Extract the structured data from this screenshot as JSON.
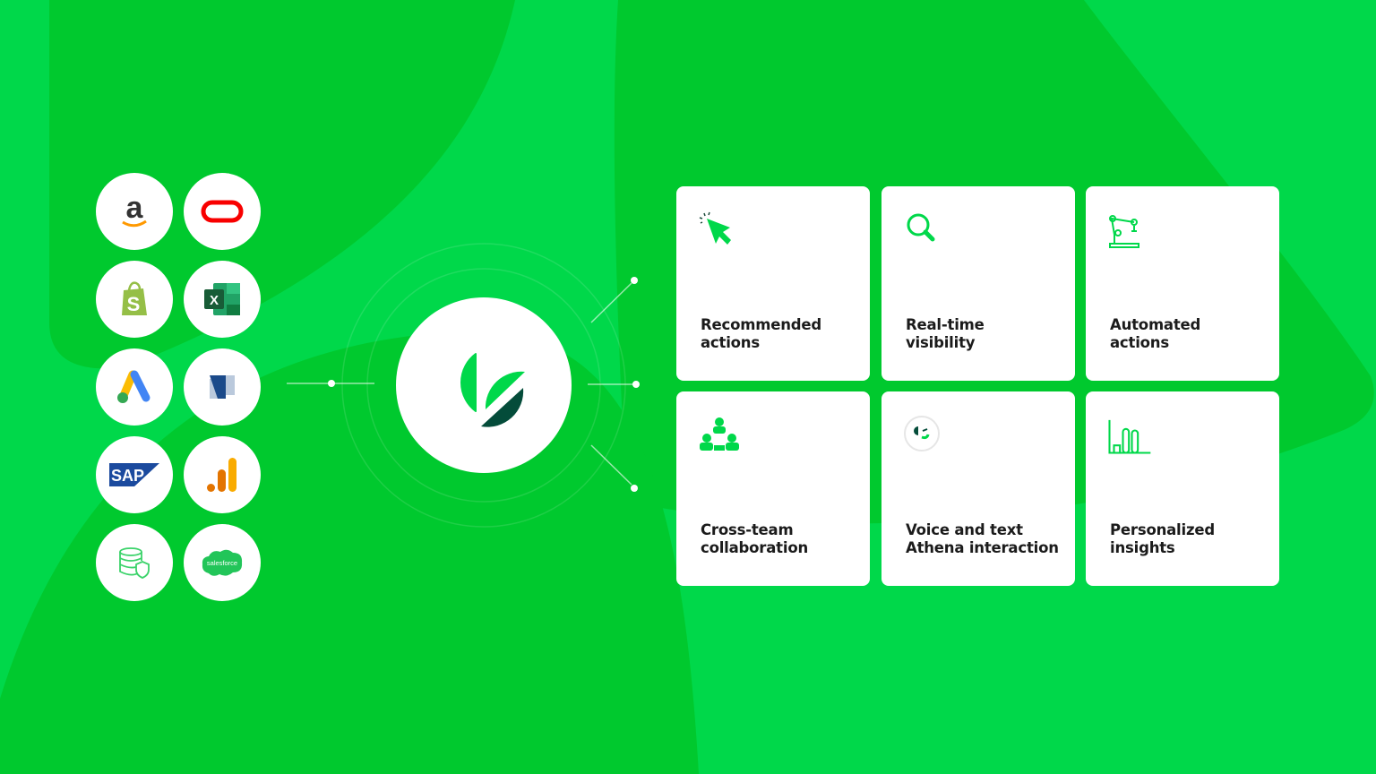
{
  "colors": {
    "brand_green": "#00d84a",
    "dark_green": "#00c92e",
    "deep_green": "#044c3a",
    "card_bg": "#ffffff"
  },
  "integrations": [
    {
      "name": "amazon",
      "text": "a"
    },
    {
      "name": "oracle"
    },
    {
      "name": "shopify",
      "text": "S"
    },
    {
      "name": "excel",
      "text": "X"
    },
    {
      "name": "google-ads"
    },
    {
      "name": "netsuite",
      "text": "N"
    },
    {
      "name": "sap",
      "text": "SAP"
    },
    {
      "name": "google-analytics"
    },
    {
      "name": "secure-database"
    },
    {
      "name": "salesforce",
      "text": "salesforce"
    }
  ],
  "features": [
    {
      "icon": "cursor-click-icon",
      "line1": "Recommended",
      "line2": "actions"
    },
    {
      "icon": "magnifier-icon",
      "line1": "Real-time",
      "line2": "visibility"
    },
    {
      "icon": "robot-arm-icon",
      "line1": "Automated",
      "line2": "actions"
    },
    {
      "icon": "team-icon",
      "line1": "Cross-team",
      "line2": "collaboration"
    },
    {
      "icon": "athena-face-icon",
      "line1": "Voice and text",
      "line2": "Athena interaction"
    },
    {
      "icon": "bar-chart-icon",
      "line1": "Personalized",
      "line2": "insights"
    }
  ]
}
